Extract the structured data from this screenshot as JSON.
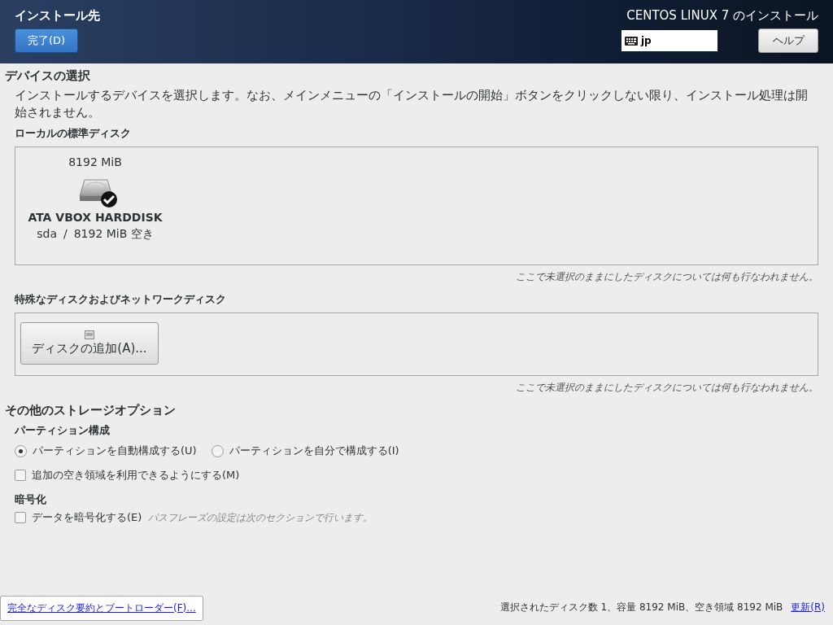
{
  "header": {
    "title": "インストール先",
    "done_button": "完了(D)",
    "product_title": "CENTOS LINUX 7 のインストール",
    "keyboard_layout": "jp",
    "help_button": "ヘルプ"
  },
  "device_selection": {
    "heading": "デバイスの選択",
    "description": "インストールするデバイスを選択します。なお、メインメニューの「インストールの開始」ボタンをクリックしない限り、インストール処理は開始されません。",
    "local_disks": {
      "heading": "ローカルの標準ディスク",
      "disks": [
        {
          "size": "8192 MiB",
          "name": "ATA VBOX HARDDISK",
          "device": "sda",
          "separator": "/",
          "free": "8192 MiB 空き",
          "selected": true
        }
      ],
      "note": "ここで未選択のままにしたディスクについては何も行なわれません。"
    },
    "special_disks": {
      "heading": "特殊なディスクおよびネットワークディスク",
      "add_button": "ディスクの追加(A)...",
      "note": "ここで未選択のままにしたディスクについては何も行なわれません。"
    }
  },
  "other_options": {
    "heading": "その他のストレージオプション",
    "partitioning": {
      "heading": "パーティション構成",
      "options": [
        {
          "label": "パーティションを自動構成する(U)",
          "selected": true
        },
        {
          "label": "パーティションを自分で構成する(I)",
          "selected": false
        }
      ],
      "reclaim": {
        "label": "追加の空き領域を利用できるようにする(M)",
        "checked": false
      }
    },
    "encryption": {
      "heading": "暗号化",
      "encrypt": {
        "label": "データを暗号化する(E)",
        "checked": false
      },
      "hint": "パスフレーズの設定は次のセクションで行います。"
    }
  },
  "footer": {
    "summary_link": "完全なディスク要約とブートローダー(F)...",
    "status": "選択されたディスク数 1、容量 8192 MiB、空き領域 8192 MiB",
    "refresh_link": "更新(R)"
  }
}
